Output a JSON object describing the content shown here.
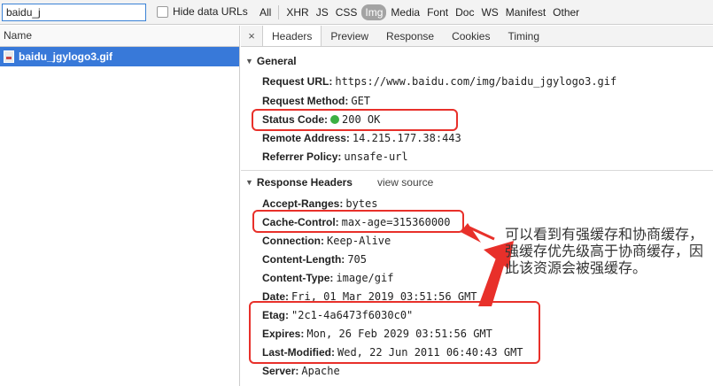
{
  "filter": {
    "search_value": "baidu_j",
    "hide_data_urls_label": "Hide data URLs",
    "types": [
      "All",
      "XHR",
      "JS",
      "CSS",
      "Img",
      "Media",
      "Font",
      "Doc",
      "WS",
      "Manifest",
      "Other"
    ],
    "active_type": "Img"
  },
  "list": {
    "header": "Name",
    "selected_request": "baidu_jgylogo3.gif"
  },
  "detail": {
    "close_label": "×",
    "tabs": [
      "Headers",
      "Preview",
      "Response",
      "Cookies",
      "Timing"
    ],
    "active_tab": "Headers",
    "general": {
      "title": "General",
      "request_url_key": "Request URL:",
      "request_url_val": "https://www.baidu.com/img/baidu_jgylogo3.gif",
      "request_method_key": "Request Method:",
      "request_method_val": "GET",
      "status_code_key": "Status Code:",
      "status_code_val": "200 OK",
      "remote_address_key": "Remote Address:",
      "remote_address_val": "14.215.177.38:443",
      "referrer_policy_key": "Referrer Policy:",
      "referrer_policy_val": "unsafe-url"
    },
    "response_headers": {
      "title": "Response Headers",
      "view_source": "view source",
      "accept_ranges_key": "Accept-Ranges:",
      "accept_ranges_val": "bytes",
      "cache_control_key": "Cache-Control:",
      "cache_control_val": "max-age=315360000",
      "connection_key": "Connection:",
      "connection_val": "Keep-Alive",
      "content_length_key": "Content-Length:",
      "content_length_val": "705",
      "content_type_key": "Content-Type:",
      "content_type_val": "image/gif",
      "date_key": "Date:",
      "date_val": "Fri, 01 Mar 2019 03:51:56 GMT",
      "etag_key": "Etag:",
      "etag_val": "\"2c1-4a6473f6030c0\"",
      "expires_key": "Expires:",
      "expires_val": "Mon, 26 Feb 2029 03:51:56 GMT",
      "last_modified_key": "Last-Modified:",
      "last_modified_val": "Wed, 22 Jun 2011 06:40:43 GMT",
      "server_key": "Server:",
      "server_val": "Apache"
    }
  },
  "annotation": {
    "text": "可以看到有强缓存和协商缓存，强缓存优先级高于协商缓存，因此该资源会被强缓存。",
    "highlight_color": "#e8302a"
  },
  "colors": {
    "selected_row": "#3879d9",
    "status_ok": "#3cb043"
  }
}
